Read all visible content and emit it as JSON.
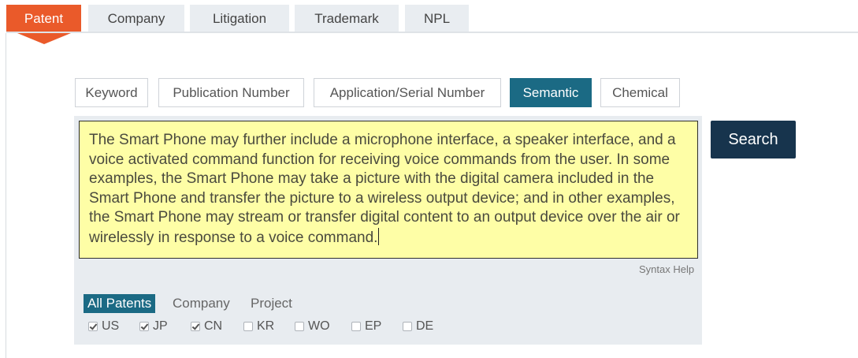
{
  "top_tabs": {
    "patent": "Patent",
    "company": "Company",
    "litigation": "Litigation",
    "trademark": "Trademark",
    "npl": "NPL"
  },
  "search_types": {
    "keyword": "Keyword",
    "publication_number": "Publication Number",
    "application_serial_number": "Application/Serial Number",
    "semantic": "Semantic",
    "chemical": "Chemical"
  },
  "query": {
    "value": "The Smart Phone may further include a microphone interface, a speaker interface, and a voice activated command function for receiving voice commands from the user. In some examples, the Smart Phone may take a picture with the digital camera included in the Smart Phone and transfer the picture to a wireless output device; and in other examples, the Smart Phone may stream or transfer digital content to an output device over the air or wirelessly in response to a voice command."
  },
  "syntax_help": "Syntax Help",
  "search_button": "Search",
  "scope_tabs": {
    "all_patents": "All Patents",
    "company": "Company",
    "project": "Project"
  },
  "offices": [
    {
      "code": "US",
      "checked": true
    },
    {
      "code": "JP",
      "checked": true
    },
    {
      "code": "CN",
      "checked": true
    },
    {
      "code": "KR",
      "checked": false
    },
    {
      "code": "WO",
      "checked": false
    },
    {
      "code": "EP",
      "checked": false
    },
    {
      "code": "DE",
      "checked": false
    }
  ],
  "colors": {
    "active_tab": "#ea5a2a",
    "semantic_active": "#1b6a84",
    "search_button": "#17344d",
    "query_background": "#fefea6",
    "panel_background": "#e8ecf0"
  }
}
